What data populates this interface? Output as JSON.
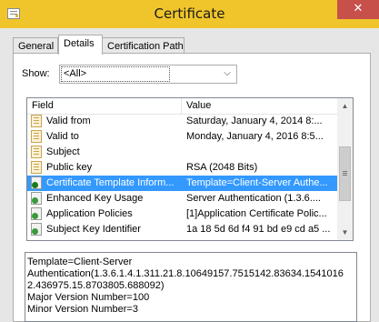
{
  "window": {
    "title": "Certificate",
    "close_glyph": "✕",
    "icon": "certificate-icon"
  },
  "tabs": [
    {
      "label": "General",
      "active": false
    },
    {
      "label": "Details",
      "active": true
    },
    {
      "label": "Certification Path",
      "active": false
    }
  ],
  "show": {
    "label": "Show:",
    "selected": "<All>"
  },
  "fields_table": {
    "columns": [
      "Field",
      "Value"
    ],
    "rows": [
      {
        "field": "Valid from",
        "value": "Saturday, January 4, 2014 8:...",
        "icon": "document-icon",
        "selected": false
      },
      {
        "field": "Valid to",
        "value": "Monday, January 4, 2016 8:5...",
        "icon": "document-icon",
        "selected": false
      },
      {
        "field": "Subject",
        "value": "",
        "icon": "document-icon",
        "selected": false
      },
      {
        "field": "Public key",
        "value": "RSA (2048 Bits)",
        "icon": "document-icon",
        "selected": false
      },
      {
        "field": "Certificate Template Inform...",
        "value": "Template=Client-Server Authe...",
        "icon": "extension-icon",
        "selected": true
      },
      {
        "field": "Enhanced Key Usage",
        "value": "Server Authentication (1.3.6....",
        "icon": "extension-icon",
        "selected": false
      },
      {
        "field": "Application Policies",
        "value": "[1]Application Certificate Polic...",
        "icon": "extension-icon",
        "selected": false
      },
      {
        "field": "Subject Key Identifier",
        "value": "1a 18 5d 6d f4 91 bd e9 cd a5 ...",
        "icon": "extension-icon",
        "selected": false
      }
    ],
    "scroll_up_glyph": "▲",
    "scroll_down_glyph": "▼",
    "scroll_grip": "≡"
  },
  "detail_text": [
    "Template=Client-Server",
    "Authentication(1.3.6.1.4.1.311.21.8.10649157.7515142.83634.1541016",
    "2.436975.15.8703805.688092)",
    "Major Version Number=100",
    "Minor Version Number=3"
  ],
  "colors": {
    "titlebar": "#f0c52b",
    "close_button": "#c7504a",
    "selection": "#3399ff"
  }
}
